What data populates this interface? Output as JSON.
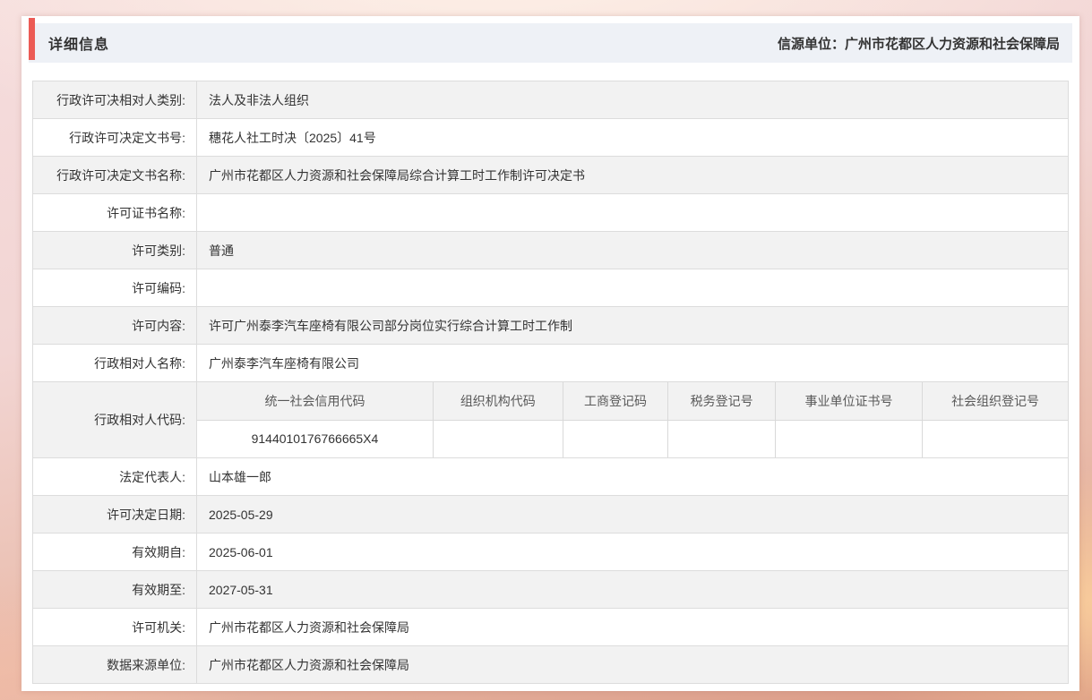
{
  "page": {
    "header": {
      "title": "详细信息",
      "source": "信源单位：广州市花都区人力资源和社会保障局"
    },
    "table": {
      "rows": [
        {
          "label": "行政许可决相对人类别:",
          "value": "法人及非法人组织"
        },
        {
          "label": "行政许可决定文书号:",
          "value": "穗花人社工时决〔2025〕41号"
        },
        {
          "label": "行政许可决定文书名称:",
          "value": "广州市花都区人力资源和社会保障局综合计算工时工作制许可决定书"
        },
        {
          "label": "许可证书名称:",
          "value": ""
        },
        {
          "label": "许可类别:",
          "value": "普通"
        },
        {
          "label": "许可编码:",
          "value": ""
        },
        {
          "label": "许可内容:",
          "value": "许可广州泰李汽车座椅有限公司部分岗位实行综合计算工时工作制"
        },
        {
          "label": "行政相对人名称:",
          "value": "广州泰李汽车座椅有限公司"
        },
        {
          "type": "code",
          "label": "行政相对人代码:",
          "columns": [
            "统一社会信用代码",
            "组织机构代码",
            "工商登记码",
            "税务登记号",
            "事业单位证书号",
            "社会组织登记号"
          ],
          "values": [
            "9144010176766665X4",
            "",
            "",
            "",
            "",
            ""
          ]
        },
        {
          "label": "法定代表人:",
          "value": "山本雄一郎"
        },
        {
          "label": "许可决定日期:",
          "value": "2025-05-29"
        },
        {
          "label": "有效期自:",
          "value": "2025-06-01"
        },
        {
          "label": "有效期至:",
          "value": "2027-05-31"
        },
        {
          "label": "许可机关:",
          "value": "广州市花都区人力资源和社会保障局"
        },
        {
          "label": "数据来源单位:",
          "value": "广州市花都区人力资源和社会保障局"
        }
      ]
    },
    "colors": {
      "accent_red": "#ec5b55",
      "header_strip_bg": "#eef1f6",
      "row_alt_bg": "#f2f2f2",
      "border": "#dcdcdc",
      "text": "#333333"
    }
  }
}
